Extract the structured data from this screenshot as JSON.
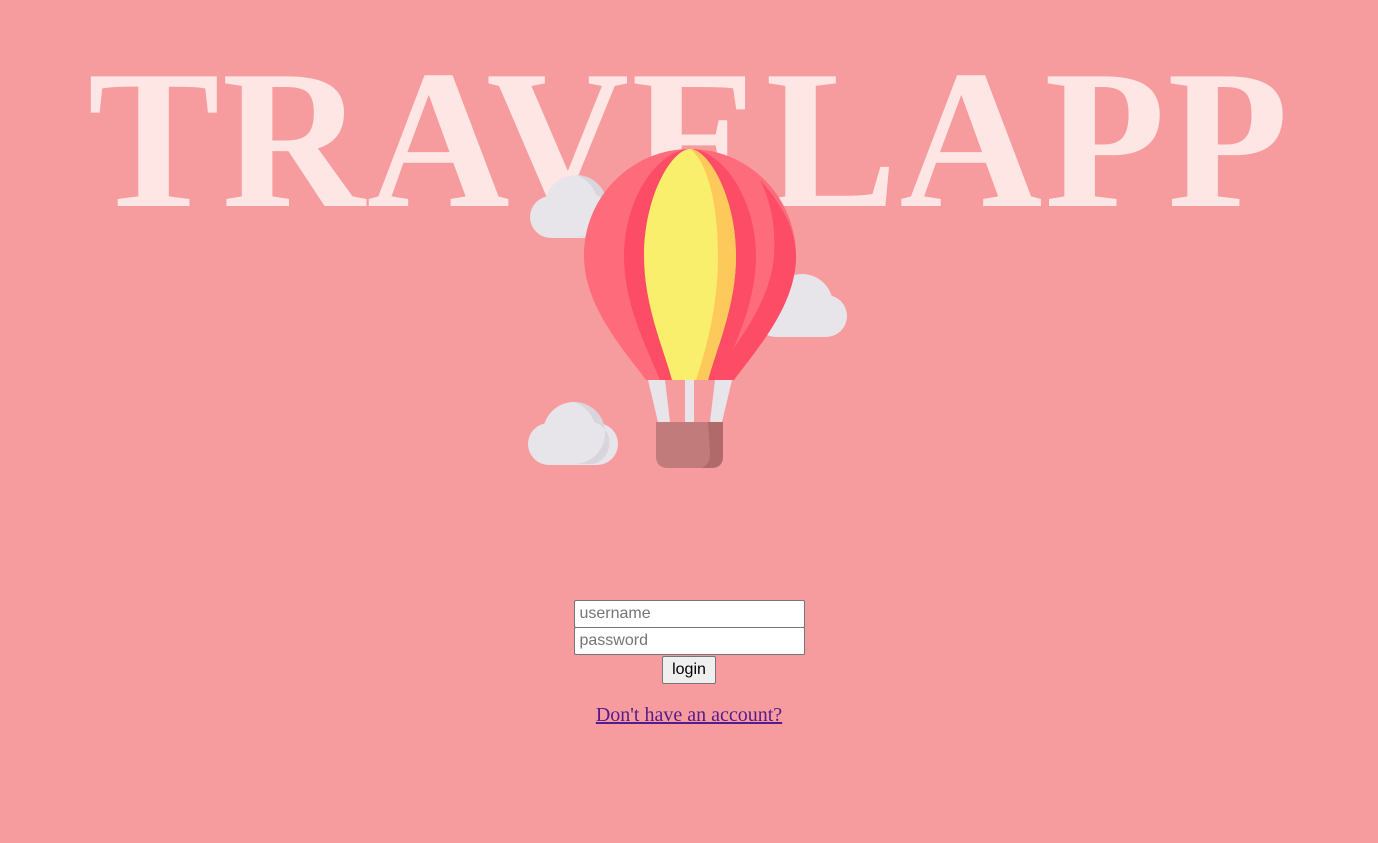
{
  "app": {
    "title": "TRAVELAPP"
  },
  "hero": {
    "image": "hot-air-balloon-icon"
  },
  "login": {
    "username_placeholder": "username",
    "username_value": "",
    "password_placeholder": "password",
    "password_value": "",
    "submit_label": "login",
    "signup_link": "Don't have an account?"
  },
  "colors": {
    "background": "#f79c9e",
    "title": "#fde6e4",
    "link": "#551a8b"
  }
}
